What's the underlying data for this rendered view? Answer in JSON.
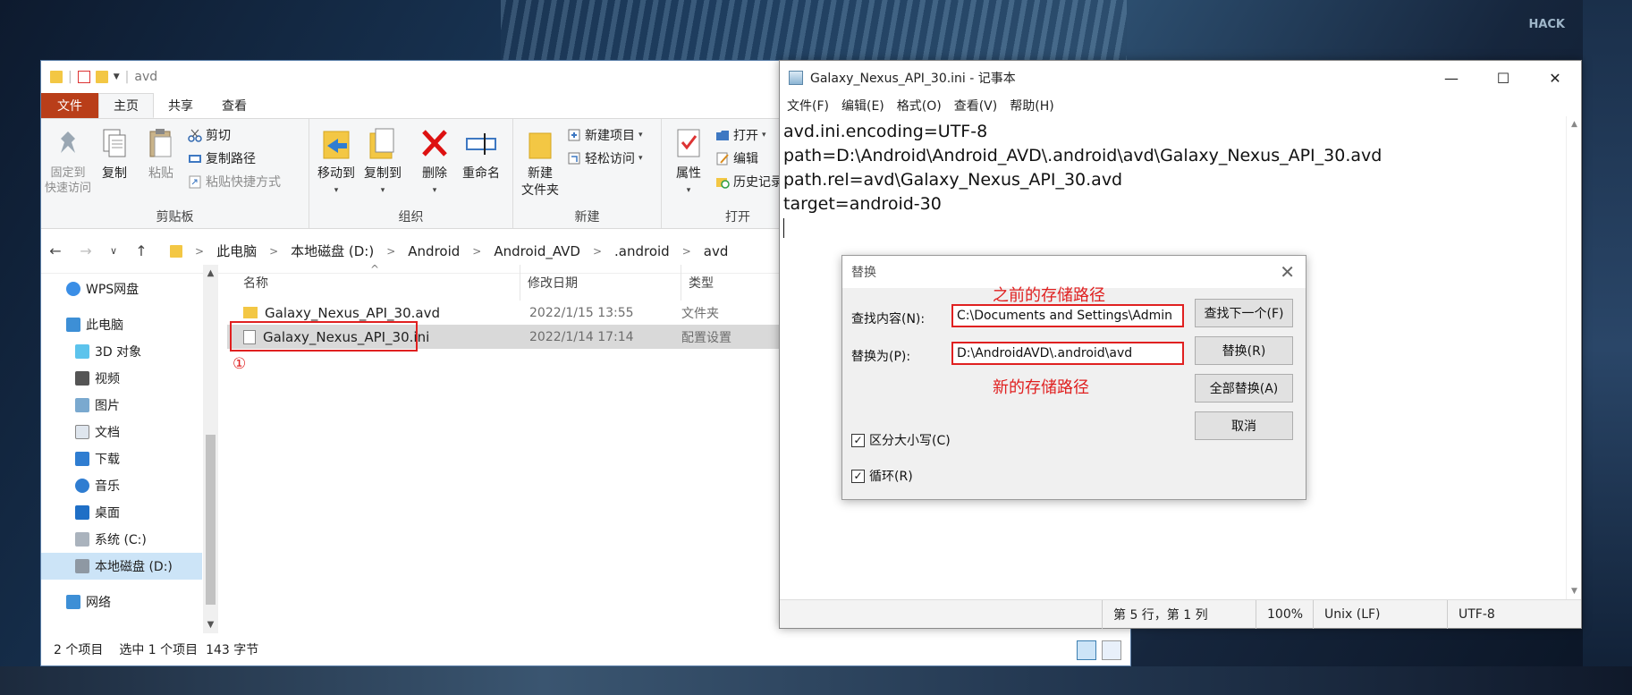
{
  "wallpaper": {
    "sign": "HACK"
  },
  "explorer": {
    "title": "avd",
    "tabs": [
      "文件",
      "主页",
      "共享",
      "查看"
    ],
    "ribbon": {
      "clipboard": {
        "label": "剪贴板",
        "pin": "固定到\n快速访问",
        "copy": "复制",
        "paste": "粘贴",
        "cut": "剪切",
        "copy_path": "复制路径",
        "paste_shortcut": "粘贴快捷方式"
      },
      "organize": {
        "label": "组织",
        "move_to": "移动到",
        "copy_to": "复制到",
        "delete": "删除",
        "rename": "重命名"
      },
      "new": {
        "label": "新建",
        "new_folder": "新建\n文件夹",
        "new_item": "新建项目",
        "easy_access": "轻松访问"
      },
      "open": {
        "label": "打开",
        "properties": "属性",
        "open": "打开",
        "edit": "编辑",
        "history": "历史记录"
      }
    },
    "breadcrumbs": [
      "此电脑",
      "本地磁盘 (D:)",
      "Android",
      "Android_AVD",
      ".android",
      "avd"
    ],
    "nav": [
      {
        "label": "WPS网盘",
        "icon": "cloud-icon"
      },
      {
        "label": "此电脑",
        "icon": "computer-icon"
      },
      {
        "label": "3D 对象",
        "icon": "cube-icon"
      },
      {
        "label": "视频",
        "icon": "video-icon"
      },
      {
        "label": "图片",
        "icon": "picture-icon"
      },
      {
        "label": "文档",
        "icon": "document-icon"
      },
      {
        "label": "下载",
        "icon": "download-icon"
      },
      {
        "label": "音乐",
        "icon": "music-icon"
      },
      {
        "label": "桌面",
        "icon": "desktop-icon"
      },
      {
        "label": "系统 (C:)",
        "icon": "drive-icon"
      },
      {
        "label": "本地磁盘 (D:)",
        "icon": "drive-icon"
      },
      {
        "label": "网络",
        "icon": "network-icon"
      }
    ],
    "columns": {
      "name": "名称",
      "date": "修改日期",
      "type": "类型"
    },
    "files": [
      {
        "name": "Galaxy_Nexus_API_30.avd",
        "date": "2022/1/15 13:55",
        "type": "文件夹"
      },
      {
        "name": "Galaxy_Nexus_API_30.ini",
        "date": "2022/1/14 17:14",
        "type": "配置设置"
      }
    ],
    "annotation_num": "①",
    "status": {
      "count": "2 个项目",
      "selected": "选中 1 个项目  143 字节"
    }
  },
  "notepad": {
    "title": "Galaxy_Nexus_API_30.ini - 记事本",
    "menu": [
      "文件(F)",
      "编辑(E)",
      "格式(O)",
      "查看(V)",
      "帮助(H)"
    ],
    "lines": [
      "avd.ini.encoding=UTF-8",
      "path=D:\\Android\\Android_AVD\\.android\\avd\\Galaxy_Nexus_API_30.avd",
      "path.rel=avd\\Galaxy_Nexus_API_30.avd",
      "target=android-30"
    ],
    "status": {
      "pos": "第 5 行，第 1 列",
      "zoom": "100%",
      "eol": "Unix (LF)",
      "enc": "UTF-8"
    }
  },
  "dialog": {
    "title": "替换",
    "find_label": "查找内容(N):",
    "find_value": "C:\\Documents and Settings\\Admin",
    "replace_label": "替换为(P):",
    "replace_value": "D:\\AndroidAVD\\.android\\avd",
    "buttons": {
      "find_next": "查找下一个(F)",
      "replace": "替换(R)",
      "replace_all": "全部替换(A)",
      "cancel": "取消"
    },
    "match_case": "区分大小写(C)",
    "wrap": "循环(R)",
    "annot_old": "之前的存储路径",
    "annot_new": "新的存储路径"
  }
}
